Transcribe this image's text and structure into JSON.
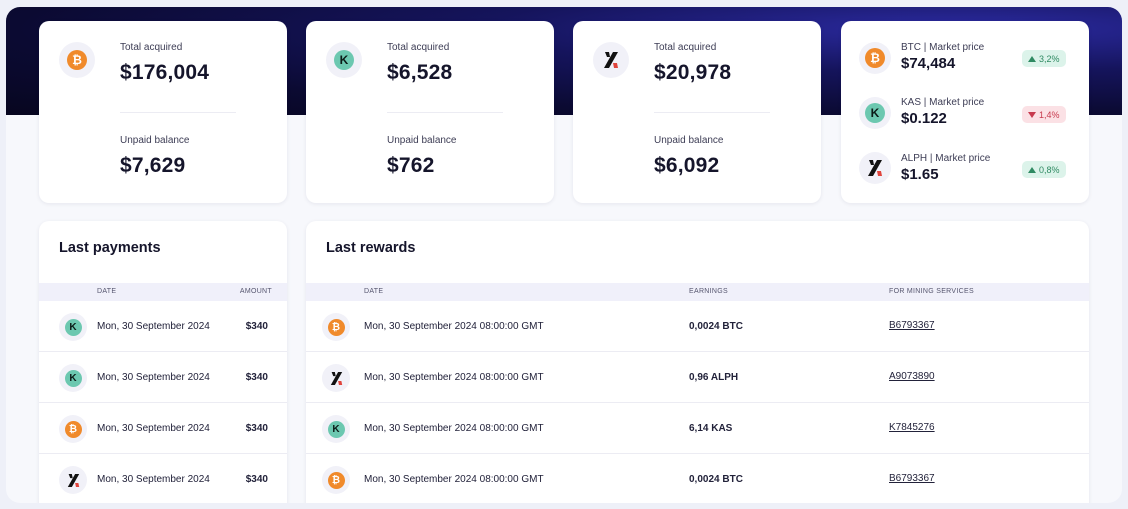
{
  "stats": [
    {
      "coin": "btc",
      "icon": "bitcoin-icon",
      "acquired_label": "Total acquired",
      "acquired": "$176,004",
      "unpaid_label": "Unpaid balance",
      "unpaid": "$7,629"
    },
    {
      "coin": "kas",
      "icon": "kaspa-icon",
      "acquired_label": "Total acquired",
      "acquired": "$6,528",
      "unpaid_label": "Unpaid balance",
      "unpaid": "$762"
    },
    {
      "coin": "alph",
      "icon": "alephium-icon",
      "acquired_label": "Total acquired",
      "acquired": "$20,978",
      "unpaid_label": "Unpaid balance",
      "unpaid": "$6,092"
    }
  ],
  "market": [
    {
      "coin": "btc",
      "label": "BTC | Market price",
      "price": "$74,484",
      "change": "3,2%",
      "direction": "up"
    },
    {
      "coin": "kas",
      "label": "KAS | Market price",
      "price": "$0.122",
      "change": "1,4%",
      "direction": "down"
    },
    {
      "coin": "alph",
      "label": "ALPH | Market price",
      "price": "$1.65",
      "change": "0,8%",
      "direction": "up"
    }
  ],
  "payments": {
    "title": "Last payments",
    "columns": {
      "date": "DATE",
      "amount": "AMOUNT"
    },
    "rows": [
      {
        "coin": "kas",
        "date": "Mon, 30 September 2024",
        "amount": "$340"
      },
      {
        "coin": "kas",
        "date": "Mon, 30 September 2024",
        "amount": "$340"
      },
      {
        "coin": "btc",
        "date": "Mon, 30 September 2024",
        "amount": "$340"
      },
      {
        "coin": "alph",
        "date": "Mon, 30 September 2024",
        "amount": "$340"
      }
    ]
  },
  "rewards": {
    "title": "Last rewards",
    "columns": {
      "date": "DATE",
      "earnings": "EARNINGS",
      "service": "FOR MINING SERVICES"
    },
    "rows": [
      {
        "coin": "btc",
        "date": "Mon, 30 September 2024 08:00:00 GMT",
        "earnings": "0,0024 BTC",
        "service": "B6793367"
      },
      {
        "coin": "alph",
        "date": "Mon, 30 September 2024 08:00:00 GMT",
        "earnings": "0,96 ALPH",
        "service": "A9073890"
      },
      {
        "coin": "kas",
        "date": "Mon, 30 September 2024 08:00:00 GMT",
        "earnings": "6,14 KAS",
        "service": "K7845276"
      },
      {
        "coin": "btc",
        "date": "Mon, 30 September 2024 08:00:00 GMT",
        "earnings": "0,0024 BTC",
        "service": "B6793367"
      }
    ]
  },
  "colors": {
    "btc": "#f08a2b",
    "kas": "#6cc8b0",
    "alph_red": "#e0443c",
    "hero": "#0b0a32",
    "up": "#2f8a62",
    "down": "#c73a4e"
  }
}
